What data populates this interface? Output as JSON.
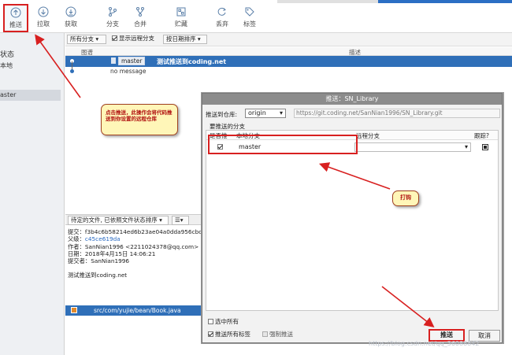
{
  "toolbar": {
    "items": [
      {
        "label": "推送",
        "icon": "upload-circle-icon"
      },
      {
        "label": "拉取",
        "icon": "download-circle-icon"
      },
      {
        "label": "获取",
        "icon": "fetch-icon"
      },
      {
        "label": "分支",
        "icon": "branch-icon"
      },
      {
        "label": "合并",
        "icon": "merge-icon"
      },
      {
        "label": "贮藏",
        "icon": "stash-icon"
      },
      {
        "label": "丢弃",
        "icon": "discard-icon"
      },
      {
        "label": "标签",
        "icon": "tag-icon"
      }
    ]
  },
  "sidebar": {
    "texts": [
      "状态",
      "本地",
      "aster"
    ]
  },
  "filterbar": {
    "branches_dropdown": "所有分支",
    "show_remote_label": "显示远程分支",
    "sort_dropdown": "按日期排序"
  },
  "graph": {
    "col_graph": "图谱",
    "col_desc": "描述",
    "rows": [
      {
        "branch": "master",
        "message": "测试推送到coding.net"
      },
      {
        "branch": "",
        "message": "no message"
      }
    ]
  },
  "lower_panel": {
    "pending_label": "待定的文件, 已依照文件状态排序",
    "commit_label": "提交：",
    "commit_hash": "f3b4c6b58214ed6b23ae04a0dda956cbc0",
    "parent_label": "父级：",
    "parent_hash": "c45ce619da",
    "author_label": "作者：",
    "author": "SanNian1996 <2211024378@qq.com>",
    "date_label": "日期：",
    "date": "2018年4月15日 14:06:21",
    "committer_label": "提交者：",
    "committer": "SanNian1996",
    "message": "测试推送到coding.net",
    "file": "src/com/yujie/bean/Book.java"
  },
  "dialog": {
    "title": "推送：SN_Library",
    "push_to_label": "推送到仓库:",
    "repo_value": "origin",
    "repo_url": "https://git.coding.net/SanNian1996/SN_Library.git",
    "branches_label": "要推送的分支",
    "col_push": "是否推",
    "col_local": "本地分支",
    "col_remote": "远程分支",
    "col_track": "跟踪?",
    "local_branch": "master",
    "select_all_label": "选中所有",
    "push_tags_label": "推送所有标签",
    "force_push_label": "强制推送",
    "push_button": "推送",
    "cancel_button": "取消"
  },
  "annotations": {
    "callout_push": "点击推送，此操作会将代码推送到你设置的远程仓库",
    "callout_check": "打钩"
  },
  "watermark": "https://blog.csdn.net/qq_36088842",
  "colors": {
    "selection": "#2f6fb8",
    "annotation_red": "#d82020",
    "callout_bg": "#fff6b8"
  }
}
